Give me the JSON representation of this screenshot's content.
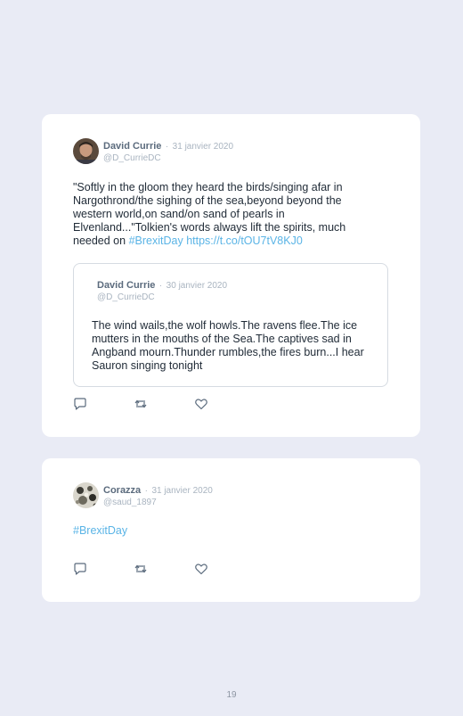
{
  "tweets": [
    {
      "author": "David Currie",
      "separator": "·",
      "date": "31 janvier 2020",
      "handle": "@D_CurrieDC",
      "text_plain": "\"Softly in the gloom they heard the birds/singing afar in Nargothrond/the sighing of the sea,beyond beyond the western world,on sand/on sand of pearls in Elvenland...\"Tolkien's words always lift the spirits, much needed on ",
      "hashtag": "#BrexitDay",
      "link": "https://t.co/tOU7tV8KJ0",
      "quoted": {
        "author": "David Currie",
        "separator": "·",
        "date": "30 janvier 2020",
        "handle": "@D_CurrieDC",
        "text": "The wind wails,the wolf howls.The ravens flee.The ice mutters in the mouths of the Sea.The captives sad in Angband mourn.Thunder rumbles,the fires burn...I hear Sauron singing tonight"
      }
    },
    {
      "author": "Corazza",
      "separator": "·",
      "date": "31 janvier 2020",
      "handle": "@saud_1897",
      "hashtag": "#BrexitDay"
    }
  ],
  "icons": [
    "reply-icon",
    "retweet-icon",
    "like-icon"
  ],
  "page_number": "19"
}
